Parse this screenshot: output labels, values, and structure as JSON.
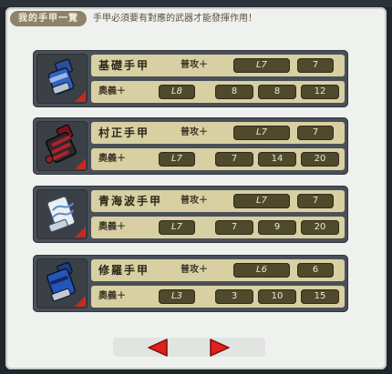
{
  "header": {
    "title": "我的手甲一覽",
    "notice": "手甲必須要有對應的武器才能發揮作用！"
  },
  "labels": {
    "attack": "普攻＋",
    "ougi": "奧義＋"
  },
  "gauntlets": [
    {
      "name": "基礎手甲",
      "icon": "blue-gauntlet-icon",
      "attack_level": "L7",
      "attack_value": "7",
      "ougi_level": "L8",
      "ougi_values": [
        "8",
        "8",
        "12"
      ]
    },
    {
      "name": "村正手甲",
      "icon": "red-black-gauntlet-icon",
      "attack_level": "L7",
      "attack_value": "7",
      "ougi_level": "L7",
      "ougi_values": [
        "7",
        "14",
        "20"
      ]
    },
    {
      "name": "青海波手甲",
      "icon": "white-blue-gauntlet-icon",
      "attack_level": "L7",
      "attack_value": "7",
      "ougi_level": "L7",
      "ougi_values": [
        "7",
        "9",
        "20"
      ]
    },
    {
      "name": "修羅手甲",
      "icon": "dark-blue-gauntlet-icon",
      "attack_level": "L6",
      "attack_value": "6",
      "ougi_level": "L3",
      "ougi_values": [
        "3",
        "10",
        "15"
      ]
    }
  ],
  "navigation": {
    "prev_icon": "left-arrow-icon",
    "next_icon": "right-arrow-icon"
  },
  "colors": {
    "arrow_red": "#e0201a",
    "card_bg": "#4a5058",
    "row_bg": "#d8d0a2",
    "pill_bg": "#4f4a2c"
  }
}
